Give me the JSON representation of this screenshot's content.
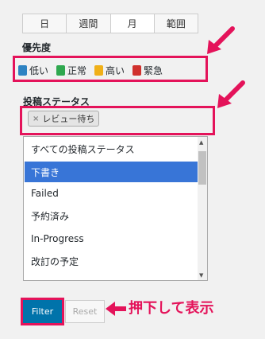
{
  "tabs": [
    "日",
    "週間",
    "月",
    "範囲"
  ],
  "priority": {
    "label": "優先度",
    "options": [
      {
        "label": "低い",
        "color": "#2e83c2"
      },
      {
        "label": "正常",
        "color": "#2fa84f"
      },
      {
        "label": "高い",
        "color": "#f0b018"
      },
      {
        "label": "緊急",
        "color": "#d0312d"
      }
    ]
  },
  "status": {
    "label": "投稿ステータス",
    "selected_token": "レビュー待ち",
    "options": [
      "すべての投稿ステータス",
      "下書き",
      "Failed",
      "予約済み",
      "In-Progress",
      "改訂の予定"
    ],
    "highlighted_index": 1
  },
  "buttons": {
    "filter": "Filter",
    "reset": "Reset"
  },
  "annotation": {
    "note": "押下して表示",
    "color": "#e4135a"
  }
}
